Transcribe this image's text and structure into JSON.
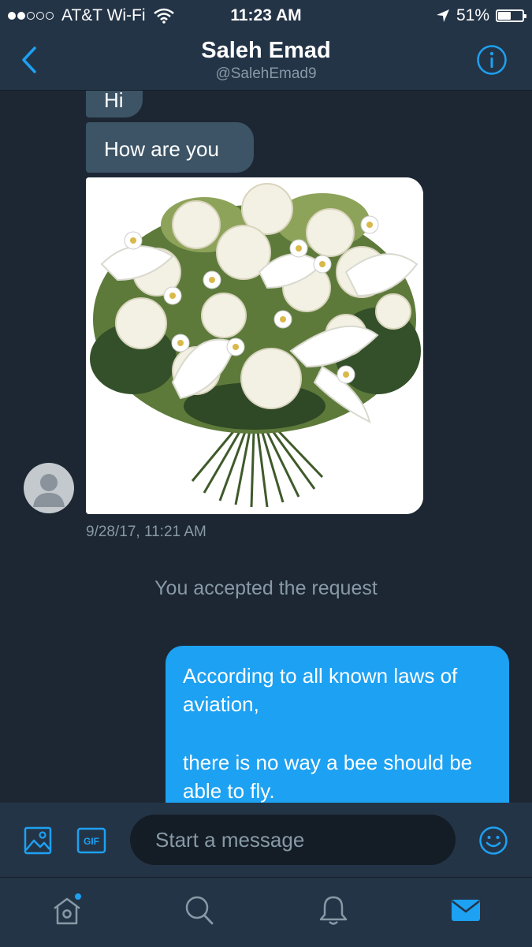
{
  "status_bar": {
    "carrier": "AT&T Wi-Fi",
    "time": "11:23 AM",
    "battery": "51%",
    "battery_level": 0.51,
    "signal_bars_filled": 2,
    "icons": [
      "wifi-icon",
      "location-arrow-icon",
      "battery-icon"
    ]
  },
  "header": {
    "name": "Saleh Emad",
    "handle": "@SalehEmad9",
    "icons": [
      "back-chevron-icon",
      "info-icon"
    ]
  },
  "conversation": {
    "incoming": [
      {
        "text": "Hi"
      },
      {
        "text": "How are you"
      },
      {
        "type": "image",
        "icon": "white-flower-bouquet-image"
      }
    ],
    "timestamp": "9/28/17, 11:21 AM",
    "system_message": "You accepted the request",
    "outgoing": {
      "line1": "According to all known laws of aviation,",
      "line2": "there is no way a bee should be able to fly."
    }
  },
  "composer": {
    "placeholder": "Start a message",
    "gif_label": "GIF",
    "icons": [
      "image-icon",
      "gif-icon",
      "emoji-icon"
    ]
  },
  "tabbar": {
    "icons": [
      "home-icon",
      "search-icon",
      "notifications-bell-icon",
      "messages-envelope-icon"
    ],
    "home_has_notification_dot": true,
    "active_tab": "messages"
  },
  "colors": {
    "background": "#1c2733",
    "bar": "#243447",
    "accent": "#1da1f2",
    "incoming_bubble": "#3d5466",
    "muted_text": "#8899a6"
  }
}
